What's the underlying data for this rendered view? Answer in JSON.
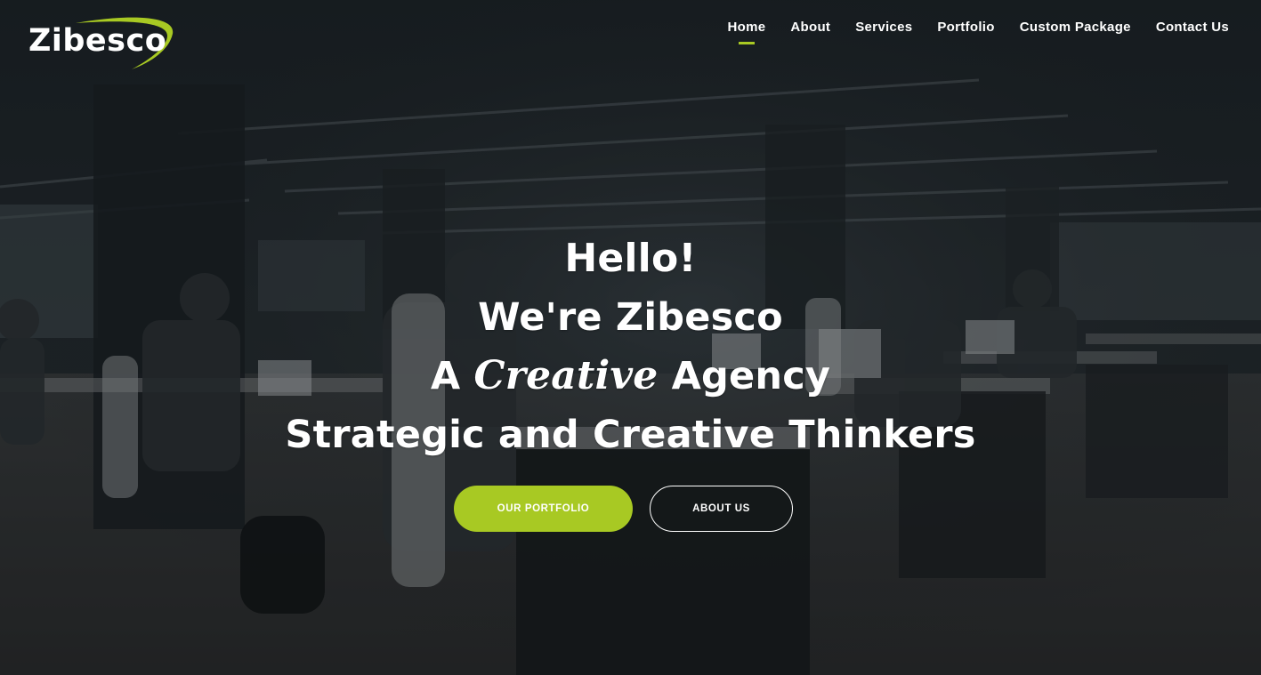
{
  "brand": {
    "name": "Zibesco",
    "accent_color": "#a8c923"
  },
  "nav": {
    "items": [
      {
        "label": "Home",
        "active": true
      },
      {
        "label": "About",
        "active": false
      },
      {
        "label": "Services",
        "active": false
      },
      {
        "label": "Portfolio",
        "active": false
      },
      {
        "label": "Custom Package",
        "active": false
      },
      {
        "label": "Contact Us",
        "active": false
      }
    ]
  },
  "hero": {
    "line1": "Hello!",
    "line2": "We're Zibesco",
    "line3_prefix": "A",
    "line3_script": "Creative",
    "line3_suffix": "Agency",
    "line4": "Strategic and Creative Thinkers",
    "background_icon": "office-workspace-photo"
  },
  "buttons": {
    "primary_label": "OUR PORTFOLIO",
    "secondary_label": "ABOUT US"
  }
}
